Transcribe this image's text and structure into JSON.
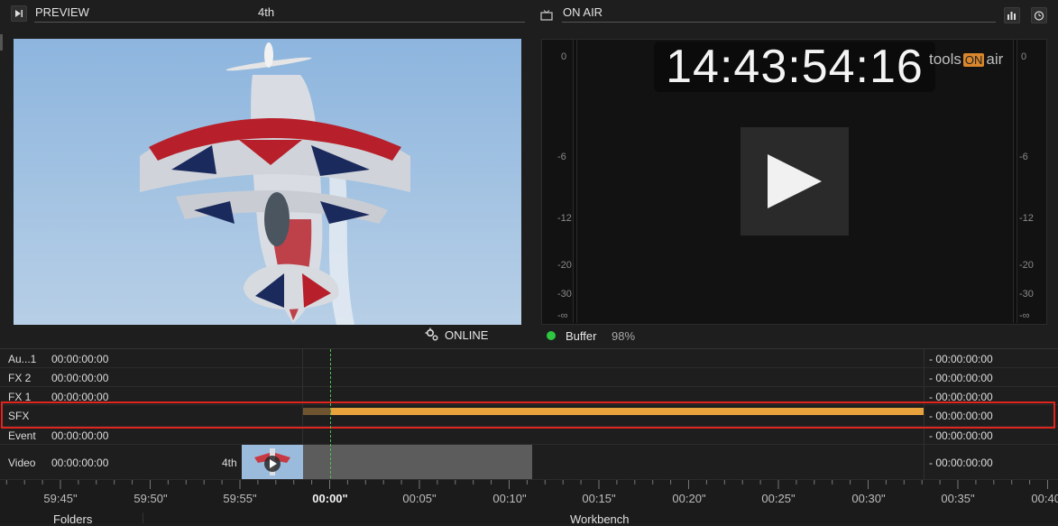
{
  "preview": {
    "title": "PREVIEW",
    "clip_name": "4th",
    "status": "ONLINE"
  },
  "onair": {
    "title": "ON AIR",
    "timecode": "14:43:54:16",
    "logo_text": "tools",
    "logo_on": "ON",
    "logo_air": "air",
    "buffer_label": "Buffer",
    "buffer_value": "98%",
    "meter_ticks": [
      "0",
      "-6",
      "-12",
      "-20",
      "-30",
      "-∞"
    ]
  },
  "tracks": [
    {
      "name": "Au...1",
      "timecode": "00:00:00:00",
      "right_timecode": "- 00:00:00:00"
    },
    {
      "name": "FX 2",
      "timecode": "00:00:00:00",
      "right_timecode": "- 00:00:00:00"
    },
    {
      "name": "FX 1",
      "timecode": "00:00:00:00",
      "right_timecode": "- 00:00:00:00"
    },
    {
      "name": "SFX",
      "timecode": "",
      "right_timecode": "- 00:00:00:00"
    },
    {
      "name": "Event",
      "timecode": "00:00:00:00",
      "right_timecode": "- 00:00:00:00"
    },
    {
      "name": "Video",
      "timecode": "00:00:00:00",
      "right_timecode": "- 00:00:00:00",
      "clip_label": "4th"
    }
  ],
  "ruler": [
    "59:45\"",
    "59:50\"",
    "59:55\"",
    "00:00\"",
    "00:05\"",
    "00:10\"",
    "00:15\"",
    "00:20\"",
    "00:25\"",
    "00:30\"",
    "00:35\"",
    "00:40\""
  ],
  "footer": {
    "left_tab": "Folders",
    "center_tab": "Workbench"
  },
  "colors": {
    "accent_orange": "#e8a33c",
    "highlight_red": "#e0241e",
    "status_green": "#2ec740"
  },
  "icons": [
    "play-preview-icon",
    "monitor-icon",
    "level-meter-icon",
    "clock-icon",
    "gear-icon",
    "play-icon"
  ]
}
